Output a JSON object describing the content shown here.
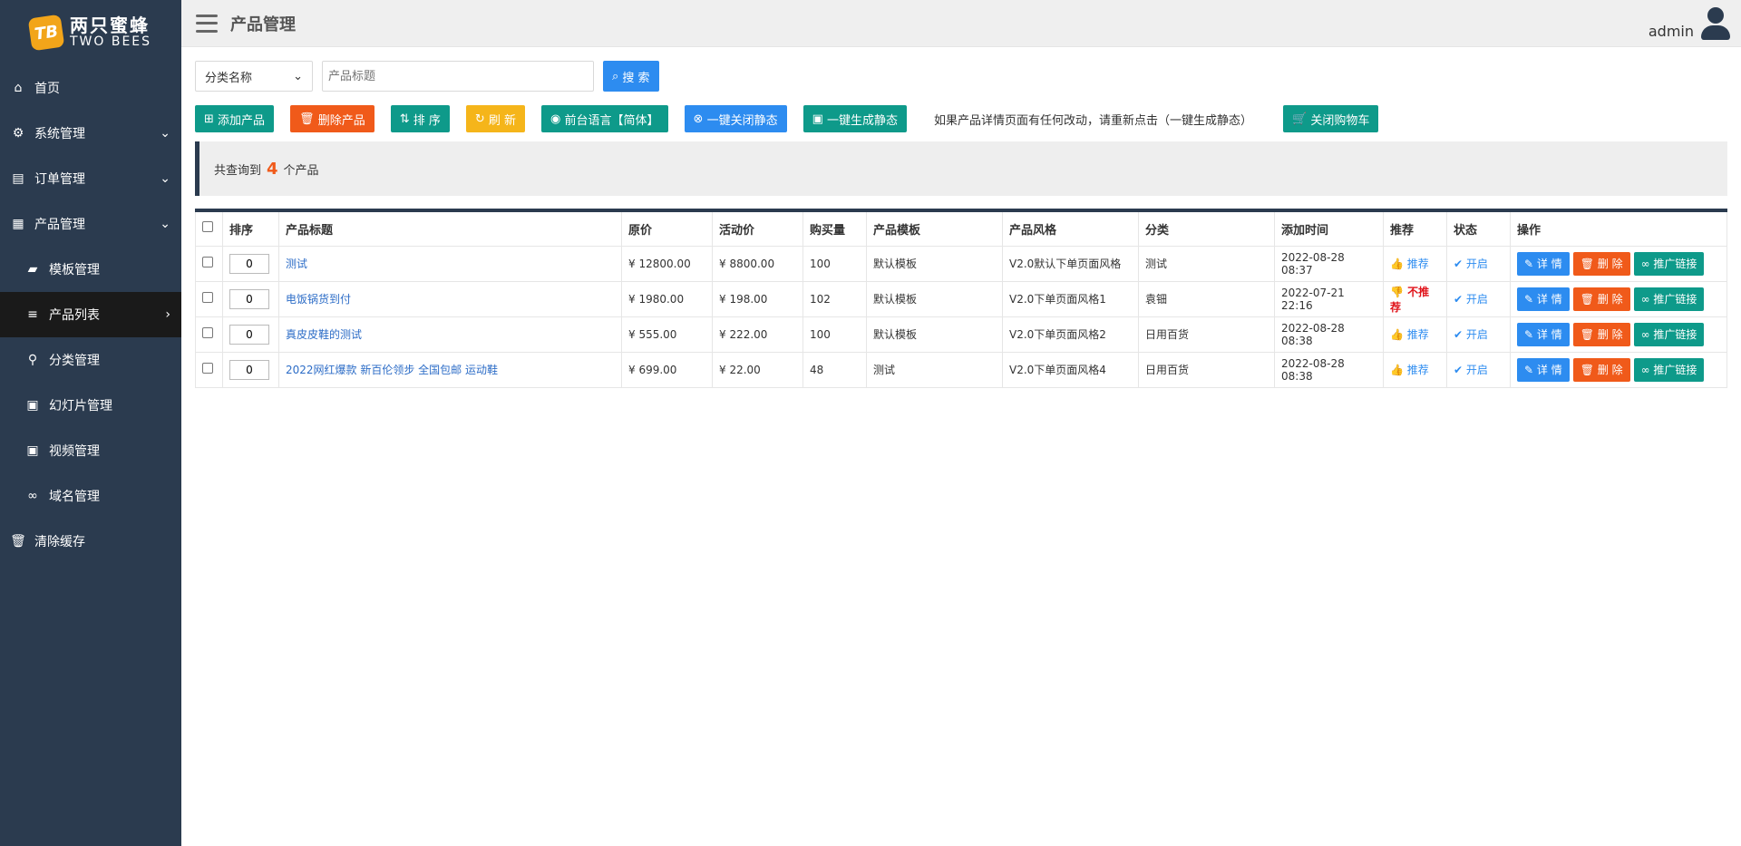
{
  "brand": {
    "badge": "TB",
    "name_cn": "两只蜜蜂",
    "name_en": "TWO BEES"
  },
  "header": {
    "title": "产品管理",
    "user": "admin"
  },
  "sidebar": {
    "items": [
      {
        "label": "首页",
        "icon": "home-icon"
      },
      {
        "label": "系统管理",
        "icon": "gear-icon"
      },
      {
        "label": "订单管理",
        "icon": "list-icon"
      },
      {
        "label": "产品管理",
        "icon": "grid-icon"
      },
      {
        "label": "模板管理",
        "icon": "folder-icon"
      },
      {
        "label": "产品列表",
        "icon": "bars-icon"
      },
      {
        "label": "分类管理",
        "icon": "sitemap-icon"
      },
      {
        "label": "幻灯片管理",
        "icon": "image-icon"
      },
      {
        "label": "视频管理",
        "icon": "video-icon"
      },
      {
        "label": "域名管理",
        "icon": "link-icon"
      },
      {
        "label": "清除缓存",
        "icon": "trash-icon"
      }
    ]
  },
  "filters": {
    "category_select": "分类名称",
    "title_placeholder": "产品标题",
    "search_label": "搜 索"
  },
  "toolbar": {
    "add": "添加产品",
    "delete": "删除产品",
    "sort": "排 序",
    "refresh": "刷 新",
    "language": "前台语言【简体】",
    "close_static": "一键关闭静态",
    "gen_static": "一键生成静态",
    "tip": "如果产品详情页面有任何改动，请重新点击（一键生成静态）",
    "close_cart": "关闭购物车"
  },
  "summary": {
    "prefix": "共查询到",
    "count": "4",
    "suffix": "个产品"
  },
  "table": {
    "headers": [
      "排序",
      "产品标题",
      "原价",
      "活动价",
      "购买量",
      "产品模板",
      "产品风格",
      "分类",
      "添加时间",
      "推荐",
      "状态",
      "操作"
    ],
    "ops": {
      "detail": "详 情",
      "delete": "删 除",
      "promote": "推广链接"
    },
    "rows": [
      {
        "sort": "0",
        "title": "测试",
        "price": "¥ 12800.00",
        "sale": "¥ 8800.00",
        "qty": "100",
        "template": "默认模板",
        "style": "V2.0默认下单页面风格",
        "category": "测试",
        "time": "2022-08-28 08:37",
        "recommend": "推荐",
        "recommended": true,
        "status": "开启"
      },
      {
        "sort": "0",
        "title": "电饭锅货到付",
        "price": "¥ 1980.00",
        "sale": "¥ 198.00",
        "qty": "102",
        "template": "默认模板",
        "style": "V2.0下单页面风格1",
        "category": "袁钿",
        "time": "2022-07-21 22:16",
        "recommend": "不推荐",
        "recommended": false,
        "status": "开启"
      },
      {
        "sort": "0",
        "title": "真皮皮鞋的测试",
        "price": "¥ 555.00",
        "sale": "¥ 222.00",
        "qty": "100",
        "template": "默认模板",
        "style": "V2.0下单页面风格2",
        "category": "日用百货",
        "time": "2022-08-28 08:38",
        "recommend": "推荐",
        "recommended": true,
        "status": "开启"
      },
      {
        "sort": "0",
        "title": "2022网红爆款 新百伦领步 全国包邮 运动鞋",
        "price": "¥ 699.00",
        "sale": "¥ 22.00",
        "qty": "48",
        "template": "测试",
        "style": "V2.0下单页面风格4",
        "category": "日用百货",
        "time": "2022-08-28 08:38",
        "recommend": "推荐",
        "recommended": true,
        "status": "开启"
      }
    ]
  },
  "colors": {
    "sidebar": "#2b3b4f",
    "green": "#0e9a8a",
    "orange": "#f05a1a",
    "blue": "#2d8cf0",
    "yellow": "#f5b51a"
  }
}
